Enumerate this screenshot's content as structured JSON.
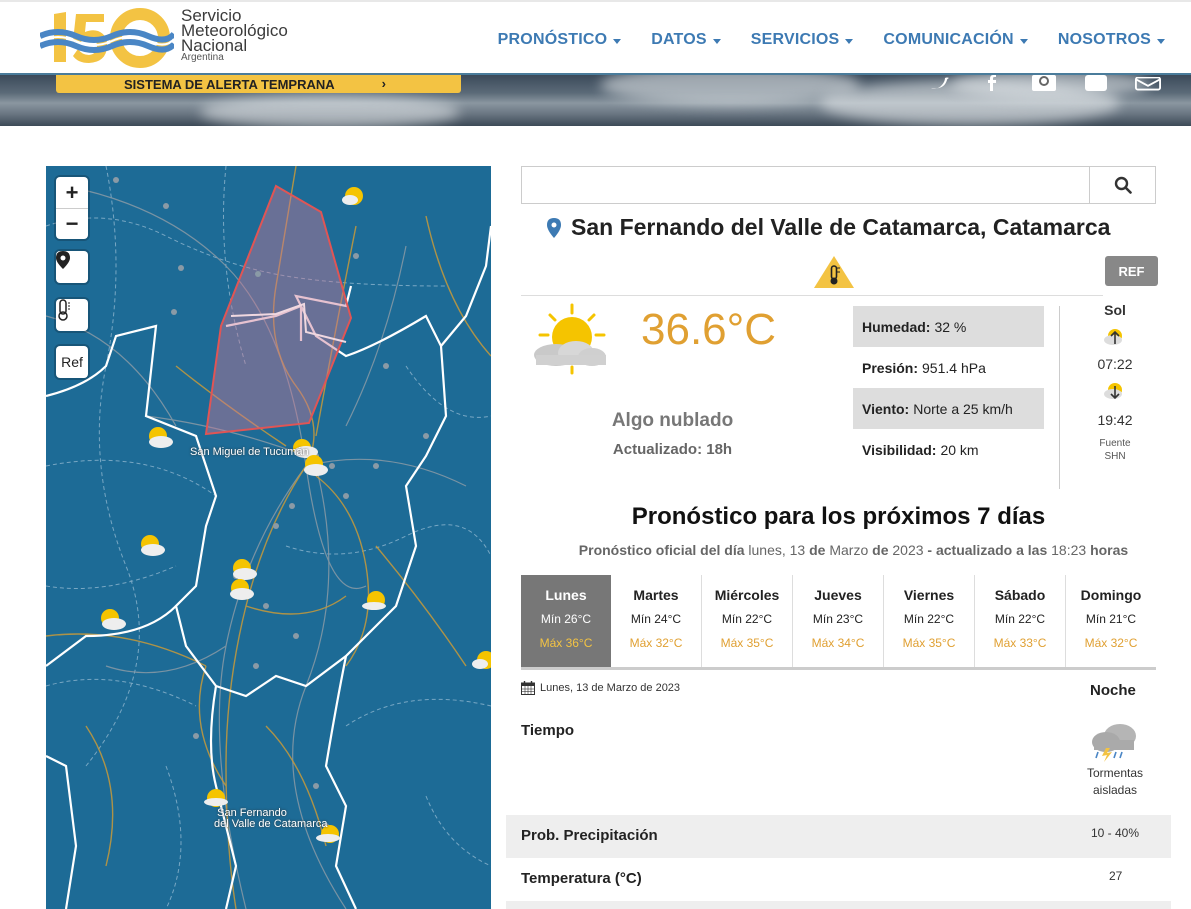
{
  "brand": {
    "mark": "150",
    "line1": "Servicio",
    "line2": "Meteorológico",
    "line3": "Nacional",
    "line4": "Argentina",
    "colors": {
      "yellow": "#f3c343",
      "blue": "#3d7ab3"
    }
  },
  "nav": [
    {
      "label": "PRONÓSTICO"
    },
    {
      "label": "DATOS"
    },
    {
      "label": "SERVICIOS"
    },
    {
      "label": "COMUNICACIÓN"
    },
    {
      "label": "NOSOTROS"
    }
  ],
  "banner": {
    "alert_label": "SISTEMA DE ALERTA TEMPRANA",
    "social": [
      "twitter-icon",
      "facebook-icon",
      "instagram-icon",
      "youtube-icon",
      "email-icon"
    ],
    "youtube_text": "You"
  },
  "map": {
    "zoom_in": "+",
    "zoom_out": "−",
    "ref_label": "Ref",
    "labels": {
      "tucuman": "San Miguel de Tucumán",
      "catamarca_1": "San Fernando",
      "catamarca_2": "del Valle de Catamarca"
    }
  },
  "search": {
    "placeholder": ""
  },
  "location": {
    "title": "San Fernando del Valle de Catamarca, Catamarca",
    "ref_button": "REF"
  },
  "current": {
    "temperature": "36.6°C",
    "description": "Algo nublado",
    "updated": "Actualizado: 18h",
    "stats": [
      {
        "label": "Humedad:",
        "value": "32 %"
      },
      {
        "label": "Presión:",
        "value": "951.4 hPa"
      },
      {
        "label": "Viento:",
        "value": "Norte a 25 km/h"
      },
      {
        "label": "Visibilidad:",
        "value": "20 km"
      }
    ]
  },
  "sun": {
    "title": "Sol",
    "sunrise": "07:22",
    "sunset": "19:42",
    "source_1": "Fuente",
    "source_2": "SHN"
  },
  "forecast": {
    "title": "Pronóstico para los próximos 7 días",
    "subtitle": {
      "prefix": "Pronóstico oficial del día",
      "weekday": "lunes, 13",
      "de1": "de",
      "month": "Marzo",
      "de2": "de",
      "year": "2023",
      "mid": "- actualizado a las",
      "time": "18:23",
      "suffix": "horas"
    },
    "days": [
      {
        "name": "Lunes",
        "min": "Mín 26°C",
        "max": "Máx 36°C",
        "selected": true
      },
      {
        "name": "Martes",
        "min": "Mín 24°C",
        "max": "Máx 32°C"
      },
      {
        "name": "Miércoles",
        "min": "Mín 22°C",
        "max": "Máx 35°C"
      },
      {
        "name": "Jueves",
        "min": "Mín 23°C",
        "max": "Máx 34°C"
      },
      {
        "name": "Viernes",
        "min": "Mín 22°C",
        "max": "Máx 35°C"
      },
      {
        "name": "Sábado",
        "min": "Mín 22°C",
        "max": "Máx 33°C"
      },
      {
        "name": "Domingo",
        "min": "Mín 21°C",
        "max": "Máx 32°C"
      }
    ],
    "detail": {
      "date": "Lunes, 13 de Marzo de 2023",
      "period": "Noche",
      "weather_label": "Tiempo",
      "weather_value_1": "Tormentas",
      "weather_value_2": "aisladas",
      "precip_label": "Prob. Precipitación",
      "precip_value": "10 - 40%",
      "temp_label": "Temperatura (°C)",
      "temp_value": "27"
    }
  }
}
